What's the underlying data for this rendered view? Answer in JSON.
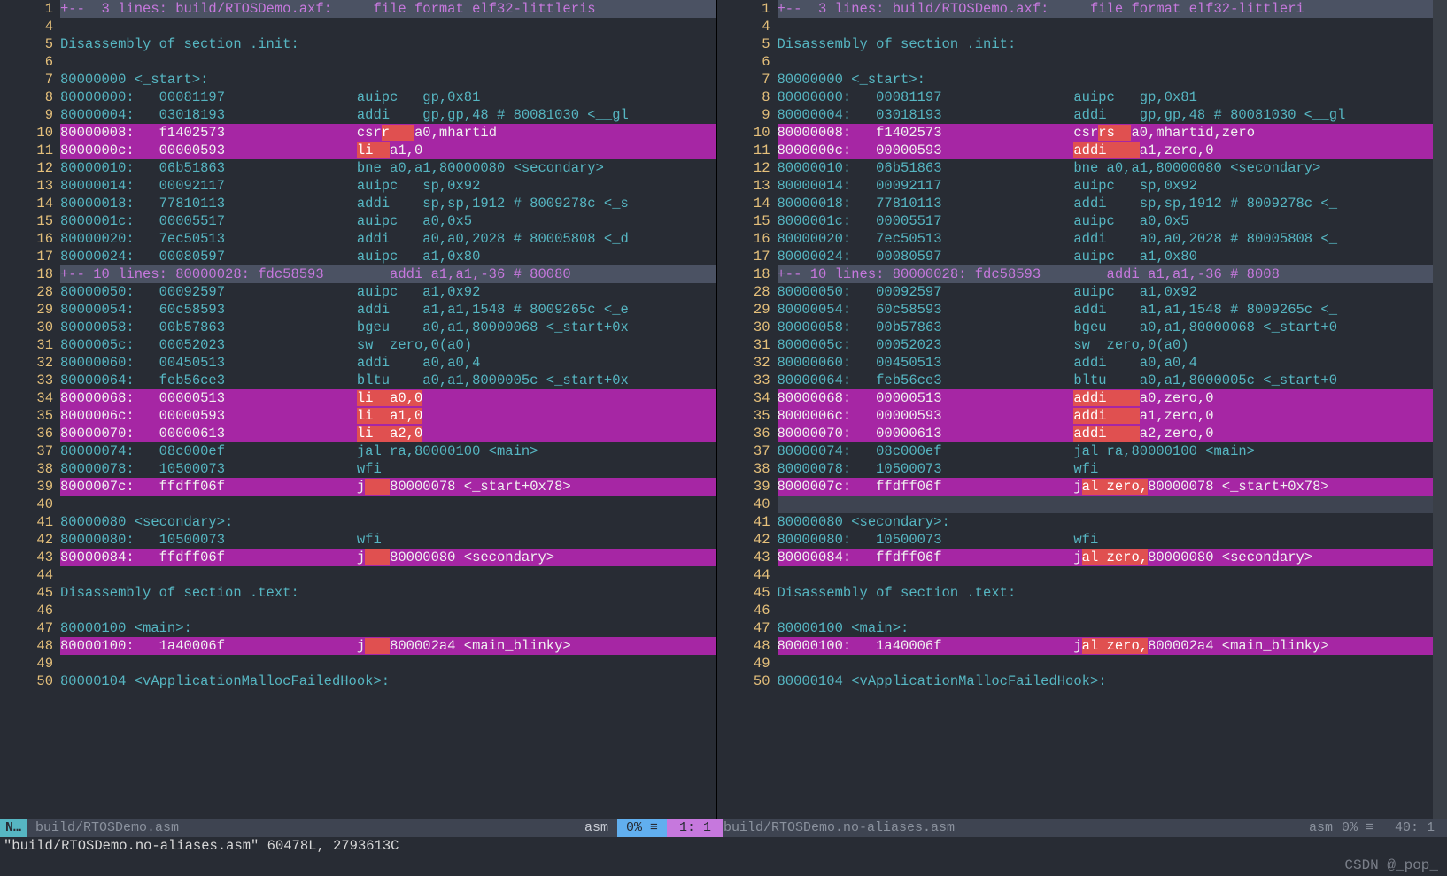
{
  "status_left": {
    "mode": "N…",
    "file": "build/RTOSDemo.asm",
    "ft": "asm",
    "pct": "0% ≡",
    "pos": "1:   1"
  },
  "status_right": {
    "file": "build/RTOSDemo.no-aliases.asm",
    "ft": "asm",
    "pct": "0% ≡",
    "pos": "40:   1"
  },
  "cmdline": "\"build/RTOSDemo.no-aliases.asm\" 60478L, 2793613C",
  "watermark": "CSDN @_pop_",
  "left": [
    {
      "n": 1,
      "fold": true,
      "t": "+--  3 lines: build/RTOSDemo.axf:     file format elf32-littleris"
    },
    {
      "n": 4,
      "t": ""
    },
    {
      "n": 5,
      "t": "Disassembly of section .init:"
    },
    {
      "n": 6,
      "t": ""
    },
    {
      "n": 7,
      "t": "80000000 <_start>:"
    },
    {
      "n": 8,
      "t": "80000000:   00081197                auipc   gp,0x81"
    },
    {
      "n": 9,
      "t": "80000004:   03018193                addi    gp,gp,48 # 80081030 <__gl"
    },
    {
      "n": 10,
      "diff": true,
      "t": "80000008:   f1402573                csr",
      "chg": "r   ",
      "t2": "a0,mhartid"
    },
    {
      "n": 11,
      "diff": true,
      "t": "8000000c:   00000593                ",
      "chg": "li  ",
      "t2": "a1,0"
    },
    {
      "n": 12,
      "t": "80000010:   06b51863                bne a0,a1,80000080 <secondary>"
    },
    {
      "n": 13,
      "t": "80000014:   00092117                auipc   sp,0x92"
    },
    {
      "n": 14,
      "t": "80000018:   77810113                addi    sp,sp,1912 # 8009278c <_s"
    },
    {
      "n": 15,
      "t": "8000001c:   00005517                auipc   a0,0x5"
    },
    {
      "n": 16,
      "t": "80000020:   7ec50513                addi    a0,a0,2028 # 80005808 <_d"
    },
    {
      "n": 17,
      "t": "80000024:   00080597                auipc   a1,0x80"
    },
    {
      "n": 18,
      "fold": true,
      "t": "+-- 10 lines: 80000028: fdc58593        addi a1,a1,-36 # 80080"
    },
    {
      "n": 28,
      "t": "80000050:   00092597                auipc   a1,0x92"
    },
    {
      "n": 29,
      "t": "80000054:   60c58593                addi    a1,a1,1548 # 8009265c <_e"
    },
    {
      "n": 30,
      "t": "80000058:   00b57863                bgeu    a0,a1,80000068 <_start+0x"
    },
    {
      "n": 31,
      "t": "8000005c:   00052023                sw  zero,0(a0)"
    },
    {
      "n": 32,
      "t": "80000060:   00450513                addi    a0,a0,4"
    },
    {
      "n": 33,
      "t": "80000064:   feb56ce3                bltu    a0,a1,8000005c <_start+0x"
    },
    {
      "n": 34,
      "diff": true,
      "t": "80000068:   00000513                ",
      "chg": "li  a0,0",
      "t2": ""
    },
    {
      "n": 35,
      "diff": true,
      "t": "8000006c:   00000593                ",
      "chg": "li  a1,0",
      "t2": ""
    },
    {
      "n": 36,
      "diff": true,
      "t": "80000070:   00000613                ",
      "chg": "li  a2,0",
      "t2": ""
    },
    {
      "n": 37,
      "t": "80000074:   08c000ef                jal ra,80000100 <main>"
    },
    {
      "n": 38,
      "t": "80000078:   10500073                wfi"
    },
    {
      "n": 39,
      "diff": true,
      "t": "8000007c:   ffdff06f                j",
      "chg": "   ",
      "t2": "80000078 <_start+0x78>"
    },
    {
      "n": 40,
      "t": ""
    },
    {
      "n": 41,
      "t": "80000080 <secondary>:"
    },
    {
      "n": 42,
      "t": "80000080:   10500073                wfi"
    },
    {
      "n": 43,
      "diff": true,
      "t": "80000084:   ffdff06f                j",
      "chg": "   ",
      "t2": "80000080 <secondary>"
    },
    {
      "n": 44,
      "t": ""
    },
    {
      "n": 45,
      "t": "Disassembly of section .text:"
    },
    {
      "n": 46,
      "t": ""
    },
    {
      "n": 47,
      "t": "80000100 <main>:"
    },
    {
      "n": 48,
      "diff": true,
      "t": "80000100:   1a40006f                j",
      "chg": "   ",
      "t2": "800002a4 <main_blinky>"
    },
    {
      "n": 49,
      "t": ""
    },
    {
      "n": 50,
      "t": "80000104 <vApplicationMallocFailedHook>:"
    }
  ],
  "right": [
    {
      "n": 1,
      "fold": true,
      "t": "+--  3 lines: build/RTOSDemo.axf:     file format elf32-littleri"
    },
    {
      "n": 4,
      "t": ""
    },
    {
      "n": 5,
      "t": "Disassembly of section .init:"
    },
    {
      "n": 6,
      "t": ""
    },
    {
      "n": 7,
      "t": "80000000 <_start>:"
    },
    {
      "n": 8,
      "t": "80000000:   00081197                auipc   gp,0x81"
    },
    {
      "n": 9,
      "t": "80000004:   03018193                addi    gp,gp,48 # 80081030 <__gl"
    },
    {
      "n": 10,
      "diff": true,
      "t": "80000008:   f1402573                csr",
      "chg": "rs  ",
      "t2": "a0,mhartid,zero"
    },
    {
      "n": 11,
      "diff": true,
      "t": "8000000c:   00000593                ",
      "chg": "addi    ",
      "t2": "a1,zero,0"
    },
    {
      "n": 12,
      "t": "80000010:   06b51863                bne a0,a1,80000080 <secondary>"
    },
    {
      "n": 13,
      "t": "80000014:   00092117                auipc   sp,0x92"
    },
    {
      "n": 14,
      "t": "80000018:   77810113                addi    sp,sp,1912 # 8009278c <_"
    },
    {
      "n": 15,
      "t": "8000001c:   00005517                auipc   a0,0x5"
    },
    {
      "n": 16,
      "t": "80000020:   7ec50513                addi    a0,a0,2028 # 80005808 <_"
    },
    {
      "n": 17,
      "t": "80000024:   00080597                auipc   a1,0x80"
    },
    {
      "n": 18,
      "fold": true,
      "t": "+-- 10 lines: 80000028: fdc58593        addi a1,a1,-36 # 8008"
    },
    {
      "n": 28,
      "t": "80000050:   00092597                auipc   a1,0x92"
    },
    {
      "n": 29,
      "t": "80000054:   60c58593                addi    a1,a1,1548 # 8009265c <_"
    },
    {
      "n": 30,
      "t": "80000058:   00b57863                bgeu    a0,a1,80000068 <_start+0"
    },
    {
      "n": 31,
      "t": "8000005c:   00052023                sw  zero,0(a0)"
    },
    {
      "n": 32,
      "t": "80000060:   00450513                addi    a0,a0,4"
    },
    {
      "n": 33,
      "t": "80000064:   feb56ce3                bltu    a0,a1,8000005c <_start+0"
    },
    {
      "n": 34,
      "diff": true,
      "t": "80000068:   00000513                ",
      "chg": "addi    ",
      "t2": "a0,zero,0"
    },
    {
      "n": 35,
      "diff": true,
      "t": "8000006c:   00000593                ",
      "chg": "addi    ",
      "t2": "a1,zero,0"
    },
    {
      "n": 36,
      "diff": true,
      "t": "80000070:   00000613                ",
      "chg": "addi    ",
      "t2": "a2,zero,0"
    },
    {
      "n": 37,
      "t": "80000074:   08c000ef                jal ra,80000100 <main>"
    },
    {
      "n": 38,
      "t": "80000078:   10500073                wfi"
    },
    {
      "n": 39,
      "diff": true,
      "t": "8000007c:   ffdff06f                j",
      "chg": "al zero,",
      "t2": "80000078 <_start+0x78>"
    },
    {
      "n": 40,
      "cursor": true,
      "t": ""
    },
    {
      "n": 41,
      "t": "80000080 <secondary>:"
    },
    {
      "n": 42,
      "t": "80000080:   10500073                wfi"
    },
    {
      "n": 43,
      "diff": true,
      "t": "80000084:   ffdff06f                j",
      "chg": "al zero,",
      "t2": "80000080 <secondary>"
    },
    {
      "n": 44,
      "t": ""
    },
    {
      "n": 45,
      "t": "Disassembly of section .text:"
    },
    {
      "n": 46,
      "t": ""
    },
    {
      "n": 47,
      "t": "80000100 <main>:"
    },
    {
      "n": 48,
      "diff": true,
      "t": "80000100:   1a40006f                j",
      "chg": "al zero,",
      "t2": "800002a4 <main_blinky>"
    },
    {
      "n": 49,
      "t": ""
    },
    {
      "n": 50,
      "t": "80000104 <vApplicationMallocFailedHook>:"
    }
  ]
}
